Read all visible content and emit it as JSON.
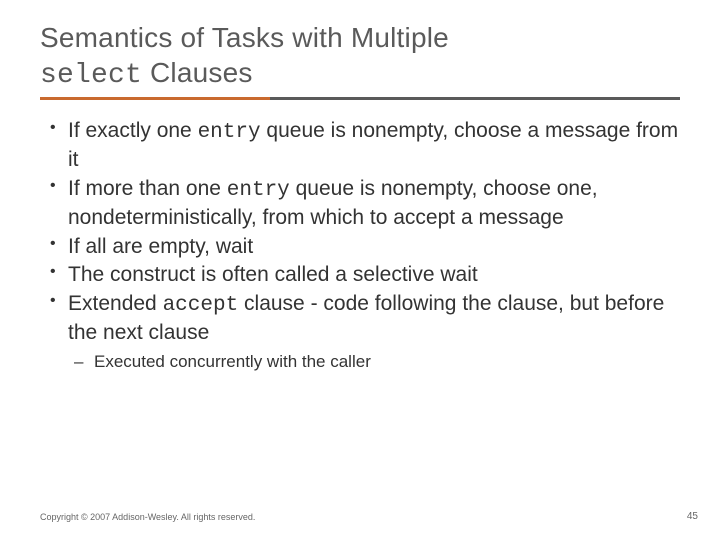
{
  "title": {
    "line1_pre": "Semantics of Tasks with Multiple ",
    "line2_mono": "select",
    "line2_rest": " Clauses"
  },
  "bullets": [
    {
      "segments": [
        {
          "t": "If exactly one "
        },
        {
          "t": "entry",
          "mono": true
        },
        {
          "t": " queue is nonempty, choose a message from it"
        }
      ]
    },
    {
      "segments": [
        {
          "t": "If more than one "
        },
        {
          "t": "entry",
          "mono": true
        },
        {
          "t": " queue is nonempty, choose one, nondeterministically, from which to accept a message"
        }
      ]
    },
    {
      "segments": [
        {
          "t": "If all are empty, wait"
        }
      ]
    },
    {
      "segments": [
        {
          "t": "The construct is often called a selective wait"
        }
      ]
    },
    {
      "segments": [
        {
          "t": "Extended "
        },
        {
          "t": "accept",
          "mono": true
        },
        {
          "t": " clause - code following the clause, but before the next clause"
        }
      ],
      "sub": [
        {
          "segments": [
            {
              "t": "Executed concurrently with the caller"
            }
          ]
        }
      ]
    }
  ],
  "footer": "Copyright © 2007 Addison-Wesley. All rights reserved.",
  "page_number": "45"
}
